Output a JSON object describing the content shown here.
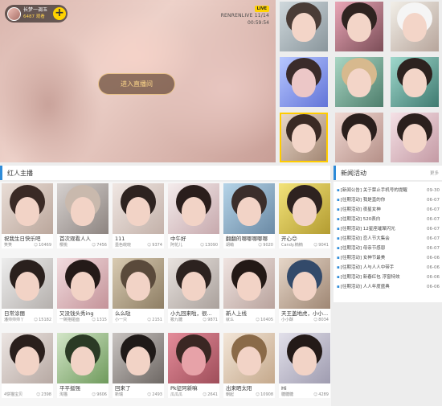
{
  "hero": {
    "streamer_name": "长梦一调玉",
    "streamer_fans": "6487 观看",
    "live_badge": "LIVE",
    "stream_id": "RENRENLIVE 11/14",
    "stream_time": "00:59:54",
    "enter_label": "进入直播间"
  },
  "sections": {
    "anchors_title": "红人主播",
    "news_title": "新闻活动",
    "more": "更多"
  },
  "anchors": [
    {
      "title": "祝我生日快乐吧",
      "user": "笑笑",
      "count": "10469"
    },
    {
      "title": "首次观看人人",
      "user": "樱桃",
      "count": "7456"
    },
    {
      "title": "111",
      "user": "墨色皖晓",
      "count": "9374"
    },
    {
      "title": "中午好",
      "user": "阿花儿",
      "count": "13090"
    },
    {
      "title": "翻翻的哪哪哪哪哪",
      "user": "胡萌",
      "count": "9020"
    },
    {
      "title": "开心😊",
      "user": "Candy.楠楠",
      "count": "9041"
    },
    {
      "title": "日常涂丽",
      "user": "潘帅帅帅丫",
      "count": "15182"
    },
    {
      "title": "又没钱头秀ing",
      "user": "一碗抱碰面",
      "count": "1315"
    },
    {
      "title": "么么哒",
      "user": "小一只",
      "count": "2151"
    },
    {
      "title": "小九回来啦，很...",
      "user": "筱九糖",
      "count": "9871"
    },
    {
      "title": "新人上线",
      "user": "就么",
      "count": "10405"
    },
    {
      "title": "天王盖地虎，小小...",
      "user": "小小酥",
      "count": "8034"
    },
    {
      "title": "",
      "user": "4饼猫宝贝",
      "count": "2398"
    },
    {
      "title": "平平挺强",
      "user": "淘猫",
      "count": "9606"
    },
    {
      "title": "回来了",
      "user": "新瑞",
      "count": "2493"
    },
    {
      "title": "Pk征阿新嘛",
      "user": "瓜瓜瓜",
      "count": "2641"
    },
    {
      "title": "出来晒太阳",
      "user": "朝起",
      "count": "10908"
    },
    {
      "title": "Hi",
      "user": "糖糖糖",
      "count": "4289"
    }
  ],
  "news": [
    {
      "title": "[新闻公告] 关于禁止手机号的提醒",
      "date": "09-30"
    },
    {
      "title": "[往期活动] 我是直的你",
      "date": "06-07"
    },
    {
      "title": "[往期活动] 夜星女神",
      "date": "06-07"
    },
    {
      "title": "[往期活动] 520表白",
      "date": "06-07"
    },
    {
      "title": "[往期活动] 12星座璀璨闪光",
      "date": "06-07"
    },
    {
      "title": "[往期活动] 恋人节大集会",
      "date": "06-07"
    },
    {
      "title": "[往期活动] 母亲节感恩",
      "date": "06-07"
    },
    {
      "title": "[往期活动] 女神节最美",
      "date": "06-06"
    },
    {
      "title": "[往期活动] 人与人人中带手",
      "date": "06-06"
    },
    {
      "title": "[往期活动] 新春红包 浮窗特效",
      "date": "06-06"
    },
    {
      "title": "[往期活动] 人人年度盛典",
      "date": "06-06"
    }
  ],
  "colors": {
    "accent_blue": "#2e8bd8",
    "live_yellow": "#ffd200",
    "enter_gold": "#ffd88a"
  }
}
